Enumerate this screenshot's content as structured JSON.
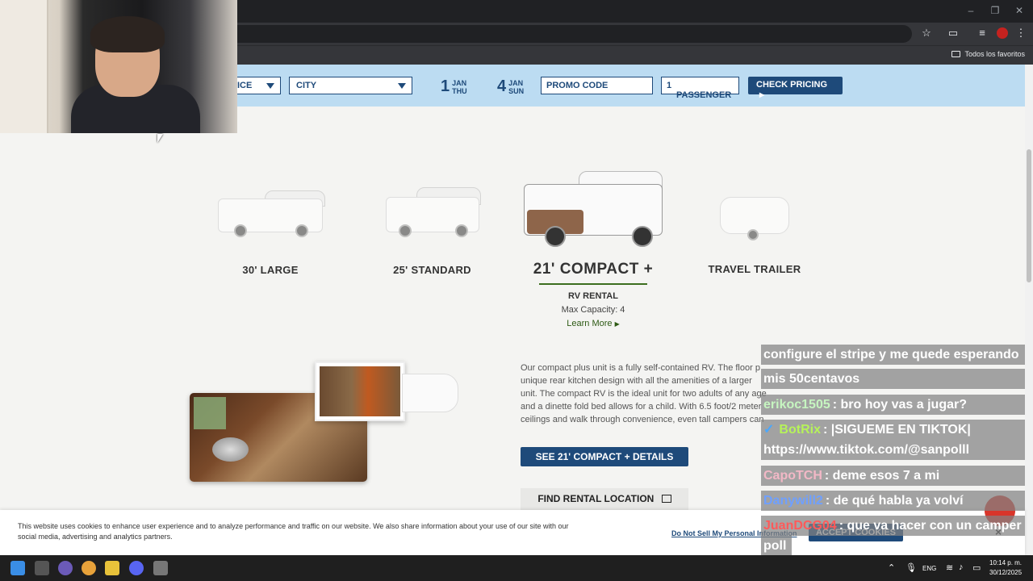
{
  "browser": {
    "bookmarks_all": "Todos los favoritos"
  },
  "booking": {
    "type_select": "ICE",
    "city_select": "CITY",
    "pickup": {
      "day": "1",
      "month": "JAN",
      "weekday": "THU"
    },
    "dropoff": {
      "day": "4",
      "month": "JAN",
      "weekday": "SUN"
    },
    "promo_placeholder": "PROMO CODE",
    "passenger_count": "1",
    "passenger_label": "PASSENGER",
    "check_pricing": "CHECK PRICING"
  },
  "rvs": [
    {
      "label": "30' LARGE"
    },
    {
      "label": "25' STANDARD"
    },
    {
      "label": "21' COMPACT +",
      "sub": "RV RENTAL",
      "capacity": "Max Capacity: 4",
      "learn_more": "Learn More"
    },
    {
      "label": "TRAVEL TRAILER"
    }
  ],
  "description": "Our compact plus unit is a fully self-contained RV. The floor p unique rear kitchen design with all the amenities of a larger unit. The compact RV is the ideal unit for two adults of any age and a dinette fold bed allows for a child. With 6.5 foot/2 meter ceilings and walk through convenience, even tall campers can enjoy the compact plus R",
  "buttons": {
    "details": "SEE 21' COMPACT + DETAILS",
    "location": "FIND RENTAL LOCATION"
  },
  "cookie": {
    "text": "This website uses cookies to enhance user experience and to analyze performance and traffic on our website. We also share information about your use of our site with our social media, advertising and analytics partners.",
    "do_not_sell": "Do Not Sell My Personal Information",
    "accept": "ACCEPT COOKIES",
    "close": "×"
  },
  "chat": [
    {
      "user": "",
      "text": "configure el stripe y me quede esperando"
    },
    {
      "user": "",
      "text": "mis 50centavos"
    },
    {
      "user": "erikoc1505",
      "user_color": "#c6f5c0",
      "text": ": bro hoy vas a jugar?"
    },
    {
      "user": "BotRix",
      "user_color": "#b6f25a",
      "text": ": |SIGUEME EN TIKTOK|"
    },
    {
      "user": "",
      "text": "https://www.tiktok.com/@sanpolll"
    },
    {
      "user": "CapoTCH",
      "user_color": "#f2b8c6",
      "text": ": deme esos 7 a mi"
    },
    {
      "user": "Danywill2",
      "user_color": "#6fa0ff",
      "text": ": de qué habla ya volví"
    },
    {
      "user": "JuanDCG04",
      "user_color": "#ff5a5a",
      "text": ": que va hacer con un camper"
    },
    {
      "user": "",
      "text": "poll"
    }
  ],
  "taskbar": {
    "language": "ENG",
    "time": "10:14 p. m.",
    "date": "30/12/2025"
  }
}
